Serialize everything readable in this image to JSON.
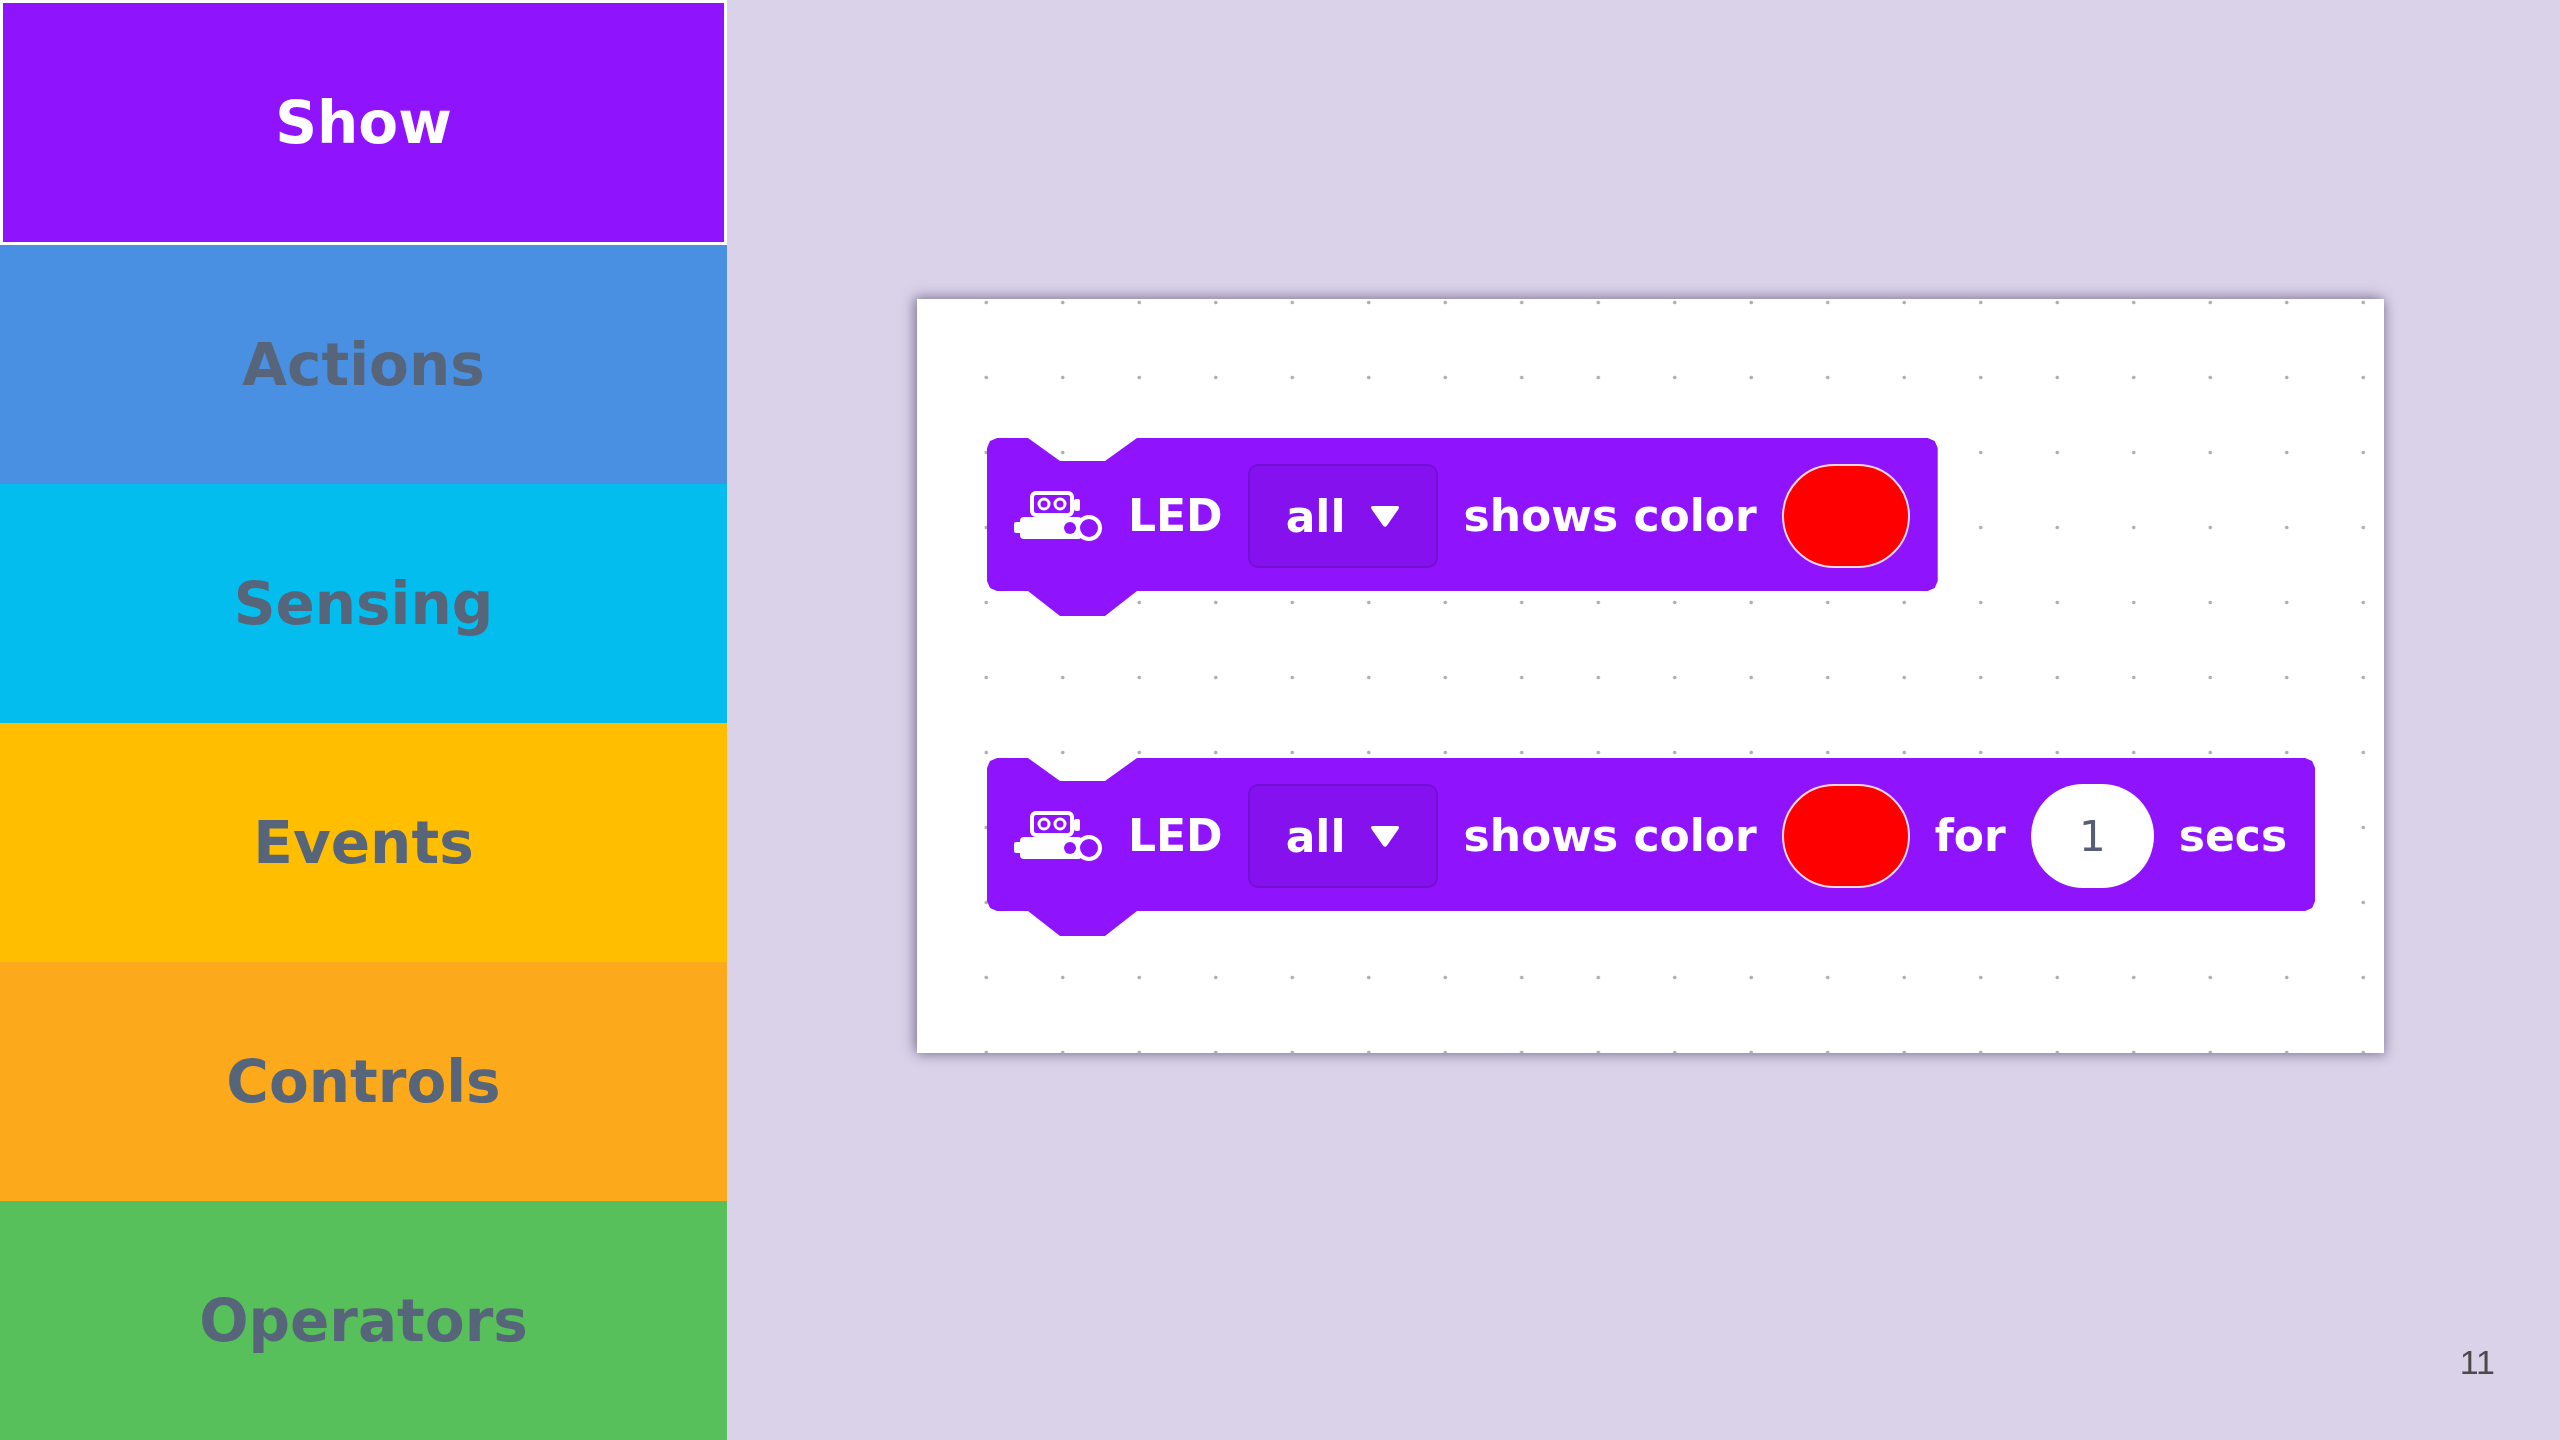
{
  "sidebar": {
    "items": [
      {
        "label": "Show",
        "selected": true,
        "color": "#9013fe"
      },
      {
        "label": "Actions",
        "selected": false,
        "color": "#4a90e2"
      },
      {
        "label": "Sensing",
        "selected": false,
        "color": "#03bdef"
      },
      {
        "label": "Events",
        "selected": false,
        "color": "#ffbf00"
      },
      {
        "label": "Controls",
        "selected": false,
        "color": "#fcaa1b"
      },
      {
        "label": "Operators",
        "selected": false,
        "color": "#58c05a"
      }
    ]
  },
  "canvas": {
    "blocks": [
      {
        "parts": [
          {
            "kind": "text",
            "text": "LED"
          },
          {
            "kind": "dropdown",
            "value": "all"
          },
          {
            "kind": "text",
            "text": "shows color"
          },
          {
            "kind": "color",
            "color": "#ff0000"
          }
        ]
      },
      {
        "parts": [
          {
            "kind": "text",
            "text": "LED"
          },
          {
            "kind": "dropdown",
            "value": "all"
          },
          {
            "kind": "text",
            "text": "shows color"
          },
          {
            "kind": "color",
            "color": "#ff0000"
          },
          {
            "kind": "text",
            "text": "for"
          },
          {
            "kind": "number",
            "value": "1"
          },
          {
            "kind": "text",
            "text": "secs"
          }
        ]
      }
    ]
  },
  "page_number": "11"
}
